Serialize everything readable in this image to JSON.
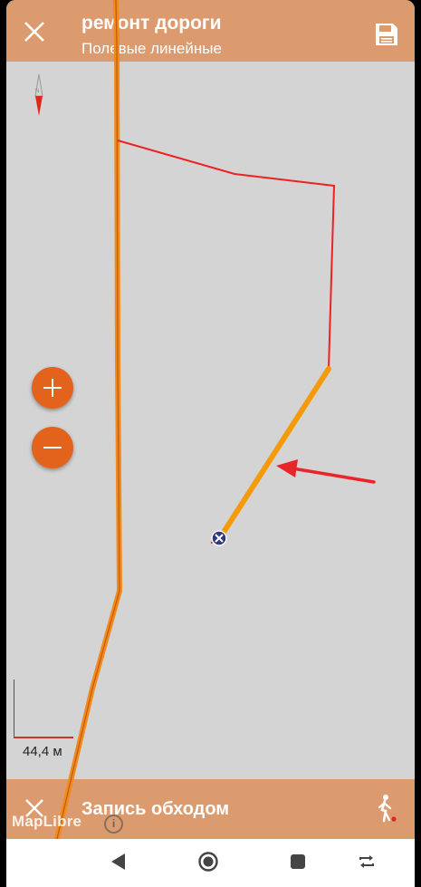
{
  "header": {
    "title": "ремонт дороги",
    "subtitle": "Полевые линейные"
  },
  "map": {
    "scale_label": "44,4 м",
    "attribution": "MapLibre",
    "colors": {
      "background": "#d4d4d4",
      "boundary": "#ee2222",
      "track": "#f59b0a",
      "annotation_arrow": "#e8262a"
    }
  },
  "recording_bar": {
    "label": "Запись обходом"
  },
  "theme": {
    "bar_color": "#dc9b6f",
    "accent": "#e4631c"
  },
  "icons": [
    "close-icon",
    "save-icon",
    "zoom-in-icon",
    "zoom-out-icon",
    "compass-icon",
    "walk-icon",
    "info-icon",
    "back-icon",
    "home-icon",
    "recents-icon",
    "rotate-icon"
  ]
}
